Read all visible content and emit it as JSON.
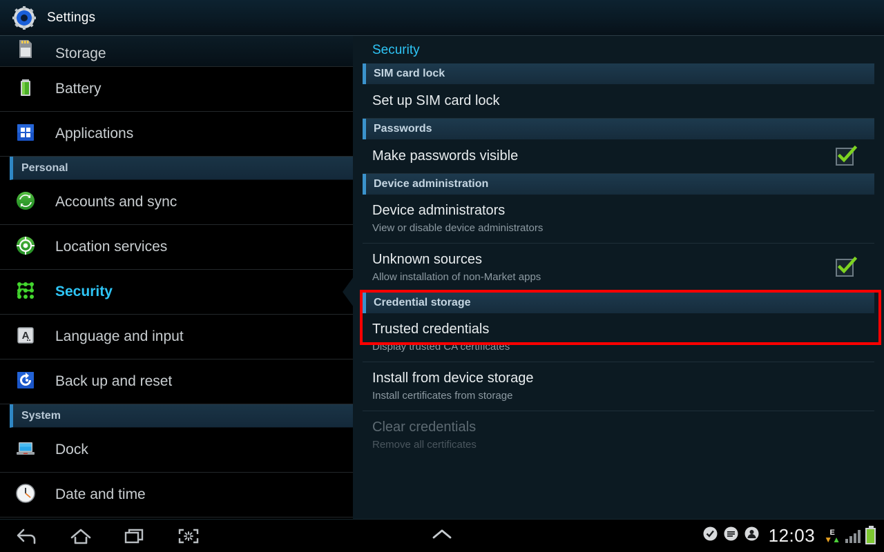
{
  "titlebar": {
    "icon": "settings-gear-icon",
    "title": "Settings"
  },
  "sidebar": {
    "rows": [
      {
        "type": "item",
        "icon": "sd-card-icon",
        "label": "Storage",
        "clipped": true,
        "selected": false
      },
      {
        "type": "item",
        "icon": "battery-icon",
        "label": "Battery",
        "clipped": false,
        "selected": false
      },
      {
        "type": "item",
        "icon": "applications-icon",
        "label": "Applications",
        "clipped": false,
        "selected": false
      },
      {
        "type": "header",
        "label": "Personal"
      },
      {
        "type": "item",
        "icon": "sync-icon",
        "label": "Accounts and sync",
        "clipped": false,
        "selected": false
      },
      {
        "type": "item",
        "icon": "location-icon",
        "label": "Location services",
        "clipped": false,
        "selected": false
      },
      {
        "type": "item",
        "icon": "pattern-lock-icon",
        "label": "Security",
        "clipped": false,
        "selected": true
      },
      {
        "type": "item",
        "icon": "keyboard-a-icon",
        "label": "Language and input",
        "clipped": false,
        "selected": false
      },
      {
        "type": "item",
        "icon": "backup-restore-icon",
        "label": "Back up and reset",
        "clipped": false,
        "selected": false
      },
      {
        "type": "header",
        "label": "System"
      },
      {
        "type": "item",
        "icon": "dock-laptop-icon",
        "label": "Dock",
        "clipped": false,
        "selected": false
      },
      {
        "type": "item",
        "icon": "clock-icon",
        "label": "Date and time",
        "clipped": false,
        "selected": false
      }
    ]
  },
  "panel": {
    "title": "Security",
    "groups": [
      {
        "header": "SIM card lock",
        "items": [
          {
            "title": "Set up SIM card lock",
            "summary": "",
            "checkbox": false,
            "checked": false,
            "disabled": false,
            "highlighted": false
          }
        ]
      },
      {
        "header": "Passwords",
        "items": [
          {
            "title": "Make passwords visible",
            "summary": "",
            "checkbox": true,
            "checked": true,
            "disabled": false,
            "highlighted": false
          }
        ]
      },
      {
        "header": "Device administration",
        "items": [
          {
            "title": "Device administrators",
            "summary": "View or disable device administrators",
            "checkbox": false,
            "checked": false,
            "disabled": false,
            "highlighted": false
          },
          {
            "title": "Unknown sources",
            "summary": "Allow installation of non-Market apps",
            "checkbox": true,
            "checked": true,
            "disabled": false,
            "highlighted": true
          }
        ]
      },
      {
        "header": "Credential storage",
        "items": [
          {
            "title": "Trusted credentials",
            "summary": "Display trusted CA certificates",
            "checkbox": false,
            "checked": false,
            "disabled": false,
            "highlighted": false
          },
          {
            "title": "Install from device storage",
            "summary": "Install certificates from storage",
            "checkbox": false,
            "checked": false,
            "disabled": false,
            "highlighted": false
          },
          {
            "title": "Clear credentials",
            "summary": "Remove all certificates",
            "checkbox": false,
            "checked": false,
            "disabled": true,
            "highlighted": false
          }
        ]
      }
    ]
  },
  "navbar": {
    "buttons": [
      {
        "name": "back-icon"
      },
      {
        "name": "home-icon"
      },
      {
        "name": "recent-apps-icon"
      },
      {
        "name": "screenshot-capture-icon"
      }
    ],
    "center_icon": "chevron-up-icon",
    "status": {
      "icons": [
        "check-bubble-icon",
        "message-bubble-icon",
        "person-bubble-icon"
      ],
      "clock": "12:03",
      "network_type": "E",
      "signal_bars": 4,
      "battery_icon": "battery-full-icon"
    }
  },
  "colors": {
    "accent_cyan": "#2ec5f6",
    "annotation_red": "#ff0000",
    "check_green": "#7ed321",
    "panel_bg": "#0c1a22",
    "sidebar_bg": "#000000"
  }
}
